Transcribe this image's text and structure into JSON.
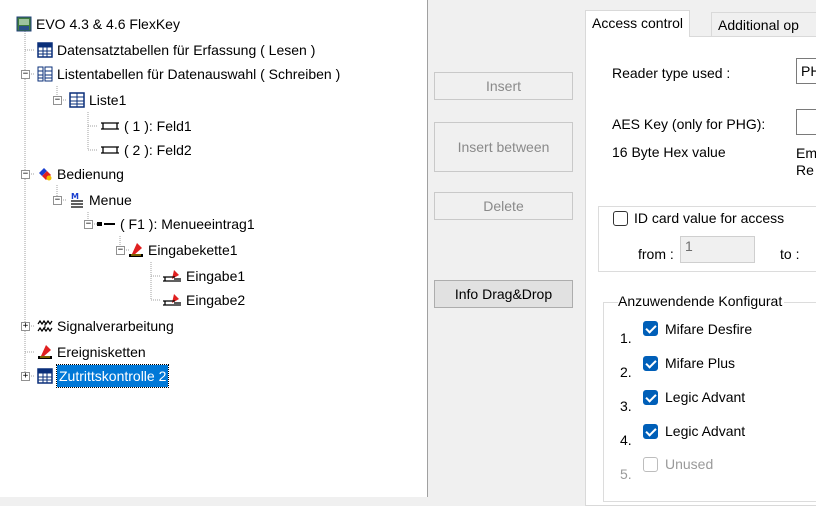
{
  "tree": {
    "nodes": [
      {
        "label": "EVO 4.3 & 4.6 FlexKey",
        "icon": "device-icon"
      },
      {
        "label": "Datensatztabellen für Erfassung ( Lesen )",
        "icon": "grid-table-icon"
      },
      {
        "label": "Listentabellen für Datenauswahl ( Schreiben )",
        "icon": "list-table-icon"
      },
      {
        "label": "Liste1",
        "icon": "list-icon"
      },
      {
        "label": "( 1 ): Feld1",
        "icon": "field-icon"
      },
      {
        "label": "( 2 ): Feld2",
        "icon": "field-icon"
      },
      {
        "label": "Bedienung",
        "icon": "operation-icon"
      },
      {
        "label": "Menue",
        "icon": "menu-icon"
      },
      {
        "label": "( F1 ): Menueeintrag1",
        "icon": "menu-entry-icon"
      },
      {
        "label": "Eingabekette1",
        "icon": "input-chain-icon"
      },
      {
        "label": "Eingabe1",
        "icon": "input-icon"
      },
      {
        "label": "Eingabe2",
        "icon": "input-icon"
      },
      {
        "label": "Signalverarbeitung",
        "icon": "signal-icon"
      },
      {
        "label": "Ereignisketten",
        "icon": "event-chain-icon"
      },
      {
        "label": "Zutrittskontrolle 2",
        "icon": "access-control-icon"
      }
    ],
    "expand_minus": "−",
    "expand_plus": "+"
  },
  "buttons": {
    "insert": "Insert",
    "insert_between": "Insert between",
    "delete": "Delete",
    "info_dragdrop": "Info Drag&Drop"
  },
  "tabs": {
    "active": "Access control",
    "inactive": "Additional op"
  },
  "form": {
    "reader_type_label": "Reader type used :",
    "reader_type_value": "PH",
    "aes_key_label": "AES Key (only for PHG):",
    "aes_key_value": "",
    "hex_label": "16 Byte Hex value",
    "hex_note_1": "Em",
    "hex_note_2": "Re",
    "id_card_label": "ID card value for access",
    "from_label": "from :",
    "from_value": "1",
    "to_label": "to :"
  },
  "config": {
    "title": "Anzuwendende Konfigurat",
    "items": [
      {
        "num": "1.",
        "label": "Mifare Desfire",
        "checked": true
      },
      {
        "num": "2.",
        "label": "Mifare Plus",
        "checked": true
      },
      {
        "num": "3.",
        "label": "Legic Advant",
        "checked": true
      },
      {
        "num": "4.",
        "label": "Legic Advant",
        "checked": true
      },
      {
        "num": "5.",
        "label": "Unused",
        "checked": false
      }
    ]
  }
}
